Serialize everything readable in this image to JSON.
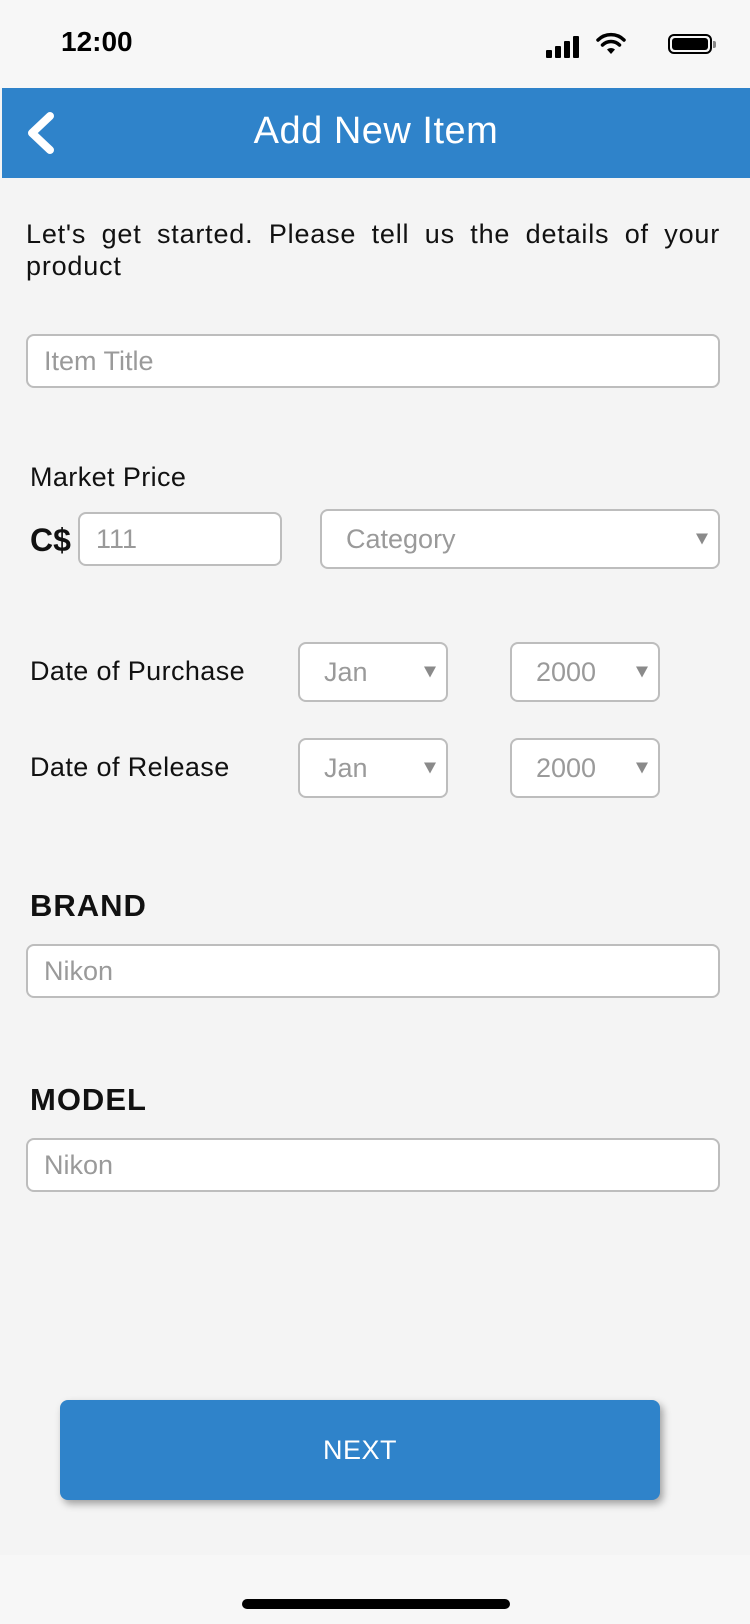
{
  "status_bar": {
    "time": "12:00",
    "icons": [
      "signal-icon",
      "wifi-icon",
      "battery-icon"
    ]
  },
  "nav": {
    "back_icon": "chevron-left-icon",
    "title": "Add New Item",
    "color": "#2f83ca"
  },
  "form": {
    "intro": "Let's get started. Please tell us the details of your product",
    "item_title": {
      "placeholder": "Item Title",
      "value": ""
    },
    "market_price": {
      "label": "Market Price",
      "currency": "C$",
      "value": "111"
    },
    "category": {
      "selected": "Category"
    },
    "date_of_purchase": {
      "label": "Date of Purchase",
      "month": "Jan",
      "year": "2000"
    },
    "date_of_release": {
      "label": "Date of Release",
      "month": "Jan",
      "year": "2000"
    },
    "brand": {
      "heading": "BRAND",
      "value": "Nikon"
    },
    "model": {
      "heading": "MODEL",
      "value": "Nikon"
    }
  },
  "actions": {
    "next_label": "NEXT"
  }
}
